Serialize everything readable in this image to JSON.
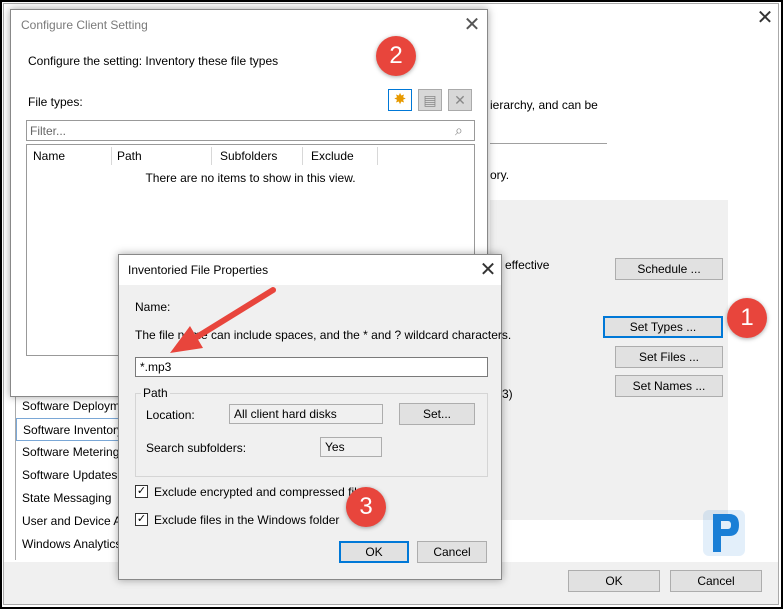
{
  "background_window": {
    "close_glyph": "✕",
    "description_lines": [
      "ierarchy, and can be",
      "ory."
    ],
    "effective_text": "effective",
    "partial_paren": "3)",
    "buttons": {
      "schedule": "Schedule ...",
      "set_types": "Set Types ...",
      "set_files": "Set Files ...",
      "set_names": "Set Names ...",
      "ok": "OK",
      "cancel": "Cancel"
    },
    "sidebar_items": [
      "Software Deployme",
      "Software Inventory",
      "Software Metering",
      "Software Updates",
      "State Messaging",
      "User and Device A",
      "Windows Analytics"
    ],
    "selected_index": 1
  },
  "configure_dialog": {
    "title": "Configure Client Setting",
    "close_glyph": "✕",
    "setting_text": "Configure the setting: Inventory these file types",
    "file_types_label": "File types:",
    "filter_placeholder": "Filter...",
    "columns": [
      "Name",
      "Path",
      "Subfolders",
      "Exclude"
    ],
    "empty_message": "There are no items to show in this view.",
    "toolbar_icons": [
      "new-star-icon",
      "properties-icon",
      "delete-icon"
    ]
  },
  "properties_dialog": {
    "title": "Inventoried File Properties",
    "close_glyph": "✕",
    "name_label": "Name:",
    "hint_text": "The file name can include spaces, and the * and ? wildcard characters.",
    "name_value": "*.mp3",
    "path_group_label": "Path",
    "location_label": "Location:",
    "location_value": "All client hard disks",
    "set_button": "Set...",
    "search_subfolders_label": "Search subfolders:",
    "search_subfolders_value": "Yes",
    "exclude_encrypted_label": "Exclude encrypted and compressed files",
    "exclude_encrypted_checked": true,
    "exclude_windows_label": "Exclude files in the Windows folder",
    "exclude_windows_checked": true,
    "ok_button": "OK",
    "cancel_button": "Cancel"
  },
  "annotations": {
    "badges": [
      "1",
      "2",
      "3"
    ],
    "badge_color": "#e8453c",
    "arrow_color": "#e8453c"
  },
  "logo": {
    "letter": "P",
    "color": "#1a7fd6"
  }
}
